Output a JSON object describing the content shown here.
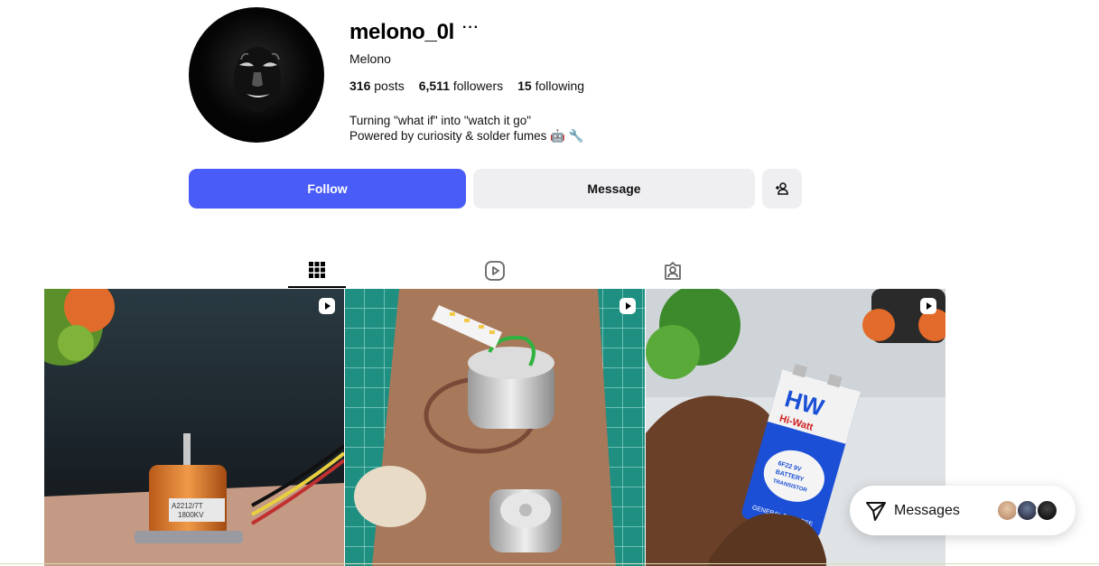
{
  "profile": {
    "username": "melono_0l",
    "full_name": "Melono",
    "posts_count": "316",
    "posts_label": "posts",
    "followers_count": "6,511",
    "followers_label": "followers",
    "following_count": "15",
    "following_label": "following",
    "bio_line1": "Turning \"what if\" into \"watch it go\"",
    "bio_line2": "Powered by curiosity & solder fumes 🤖 🔧",
    "more_icon": "more-horizontal-icon"
  },
  "actions": {
    "follow_label": "Follow",
    "message_label": "Message",
    "add_user_icon": "add-user-icon"
  },
  "tabs": [
    {
      "name": "posts",
      "icon": "grid-icon",
      "active": true
    },
    {
      "name": "reels",
      "icon": "reels-icon",
      "active": false
    },
    {
      "name": "tagged",
      "icon": "tagged-icon",
      "active": false
    }
  ],
  "posts": [
    {
      "type": "reel",
      "caption_text": "A2212/7T 1800KV",
      "icon": "reel-icon"
    },
    {
      "type": "reel",
      "icon": "reel-icon"
    },
    {
      "type": "reel",
      "caption_text": "HW Hi-Watt 6F22 9V BATTERY FOR TRANSISTOR RADIOS GENERAL PURPOSE",
      "icon": "reel-icon"
    }
  ],
  "messages": {
    "label": "Messages",
    "icon": "send-icon"
  },
  "colors": {
    "accent": "#4a5cf7",
    "button_secondary": "#efeff2"
  }
}
